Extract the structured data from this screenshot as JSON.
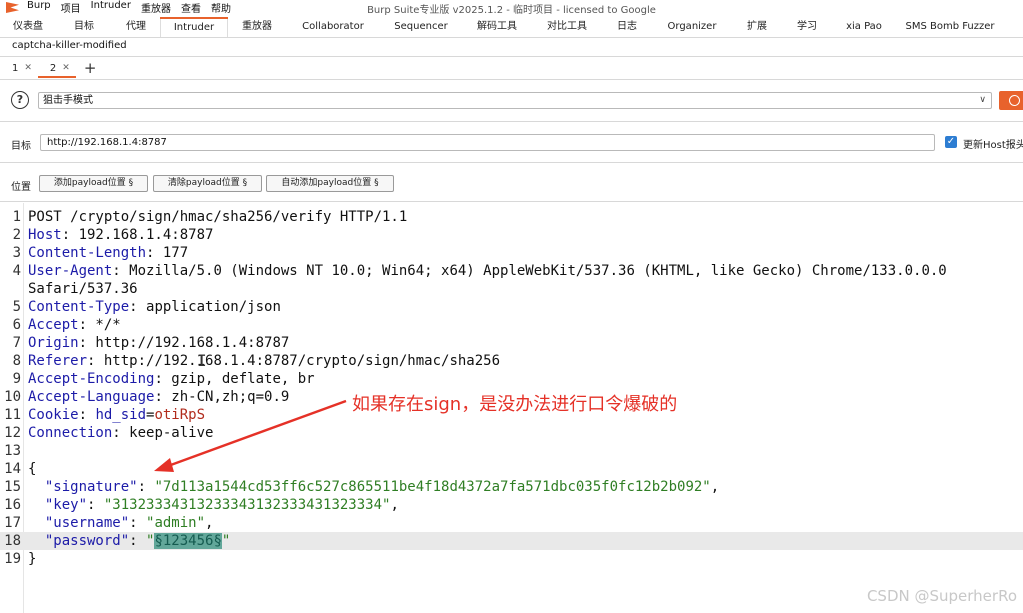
{
  "menu": [
    "Burp",
    "项目",
    "Intruder",
    "重放器",
    "查看",
    "帮助"
  ],
  "window_title": "Burp Suite专业版  v2025.1.2 - 临时项目 - licensed to Google",
  "main_tabs": [
    {
      "label": "仪表盘",
      "w": 56
    },
    {
      "label": "目标",
      "w": 56
    },
    {
      "label": "代理",
      "w": 48
    },
    {
      "label": "Intruder",
      "w": 68
    },
    {
      "label": "重放器",
      "w": 58
    },
    {
      "label": "Collaborator",
      "w": 94
    },
    {
      "label": "Sequencer",
      "w": 82
    },
    {
      "label": "解码工具",
      "w": 70
    },
    {
      "label": "对比工具",
      "w": 70
    },
    {
      "label": "日志",
      "w": 50
    },
    {
      "label": "Organizer",
      "w": 80
    },
    {
      "label": "扩展",
      "w": 50
    },
    {
      "label": "学习",
      "w": 50
    },
    {
      "label": "xia Pao",
      "w": 64
    },
    {
      "label": "SMS Bomb Fuzzer",
      "w": 108
    }
  ],
  "sub_tab": "captcha-killer-modified",
  "request_tabs": [
    "1",
    "2"
  ],
  "attack": {
    "mode": "狙击手模式"
  },
  "target": {
    "label": "目标",
    "value": "http://192.168.1.4:8787",
    "update_host_label": "更新Host报头"
  },
  "positions": {
    "label": "位置",
    "add": "添加payload位置 §",
    "clear": "清除payload位置 §",
    "auto": "自动添加payload位置 §"
  },
  "request_lines": [
    {
      "n": "1",
      "parts": [
        {
          "t": "POST /crypto/sign/hmac/sha256/verify HTTP/1.1",
          "c": ""
        }
      ]
    },
    {
      "n": "2",
      "parts": [
        {
          "t": "Host",
          "c": "hk"
        },
        {
          "t": ": 192.168.1.4:8787",
          "c": ""
        }
      ]
    },
    {
      "n": "3",
      "parts": [
        {
          "t": "Content-Length",
          "c": "hk"
        },
        {
          "t": ": 177",
          "c": ""
        }
      ]
    },
    {
      "n": "4",
      "parts": [
        {
          "t": "User-Agent",
          "c": "hk"
        },
        {
          "t": ": Mozilla/5.0 (Windows NT 10.0; Win64; x64) AppleWebKit/537.36 (KHTML, like Gecko) Chrome/133.0.0.0",
          "c": ""
        }
      ]
    },
    {
      "n": "",
      "parts": [
        {
          "t": "Safari/537.36",
          "c": ""
        }
      ]
    },
    {
      "n": "5",
      "parts": [
        {
          "t": "Content-Type",
          "c": "hk"
        },
        {
          "t": ": application/json",
          "c": ""
        }
      ]
    },
    {
      "n": "6",
      "parts": [
        {
          "t": "Accept",
          "c": "hk"
        },
        {
          "t": ": */*",
          "c": ""
        }
      ]
    },
    {
      "n": "7",
      "parts": [
        {
          "t": "Origin",
          "c": "hk"
        },
        {
          "t": ": http://192.168.1.4:8787",
          "c": ""
        }
      ]
    },
    {
      "n": "8",
      "parts": [
        {
          "t": "Referer",
          "c": "hk"
        },
        {
          "t": ": http://192.168.1.4:8787/crypto/sign/hmac/sha256",
          "c": ""
        }
      ]
    },
    {
      "n": "9",
      "parts": [
        {
          "t": "Accept-Encoding",
          "c": "hk"
        },
        {
          "t": ": gzip, deflate, br",
          "c": ""
        }
      ]
    },
    {
      "n": "10",
      "parts": [
        {
          "t": "Accept-Language",
          "c": "hk"
        },
        {
          "t": ": zh-CN,zh;q=0.9",
          "c": ""
        }
      ]
    },
    {
      "n": "11",
      "parts": [
        {
          "t": "Cookie",
          "c": "hk"
        },
        {
          "t": ": ",
          "c": ""
        },
        {
          "t": "hd_sid",
          "c": "hk"
        },
        {
          "t": "=",
          "c": ""
        },
        {
          "t": "otiRpS",
          "c": "cookie"
        }
      ]
    },
    {
      "n": "12",
      "parts": [
        {
          "t": "Connection",
          "c": "hk"
        },
        {
          "t": ": keep-alive",
          "c": ""
        }
      ]
    },
    {
      "n": "13",
      "parts": []
    },
    {
      "n": "14",
      "parts": [
        {
          "t": "{",
          "c": ""
        }
      ]
    },
    {
      "n": "15",
      "parts": [
        {
          "t": "  \"signature\"",
          "c": "jk"
        },
        {
          "t": ": ",
          "c": ""
        },
        {
          "t": "\"7d113a1544cd53ff6c527c865511be4f18d4372a7fa571dbc035f0fc12b2b092\"",
          "c": "jv"
        },
        {
          "t": ",",
          "c": ""
        }
      ]
    },
    {
      "n": "16",
      "parts": [
        {
          "t": "  \"key\"",
          "c": "jk"
        },
        {
          "t": ": ",
          "c": ""
        },
        {
          "t": "\"31323334313233343132333431323334\"",
          "c": "jv"
        },
        {
          "t": ",",
          "c": ""
        }
      ]
    },
    {
      "n": "17",
      "parts": [
        {
          "t": "  \"username\"",
          "c": "jk"
        },
        {
          "t": ": ",
          "c": ""
        },
        {
          "t": "\"admin\"",
          "c": "jv"
        },
        {
          "t": ",",
          "c": ""
        }
      ]
    },
    {
      "n": "18",
      "parts": [
        {
          "t": "  \"password\"",
          "c": "jk"
        },
        {
          "t": ": ",
          "c": ""
        },
        {
          "t": "\"",
          "c": "jv"
        },
        {
          "t": "§123456§",
          "c": "payload"
        },
        {
          "t": "\"",
          "c": "jv"
        }
      ],
      "hl": true
    },
    {
      "n": "19",
      "parts": [
        {
          "t": "}",
          "c": ""
        }
      ]
    }
  ],
  "annotation": "如果存在sign，是没办法进行口令爆破的",
  "watermark": "CSDN @SuperherRo",
  "colors": {
    "accent": "#e8622c",
    "annotation": "#e53127"
  }
}
